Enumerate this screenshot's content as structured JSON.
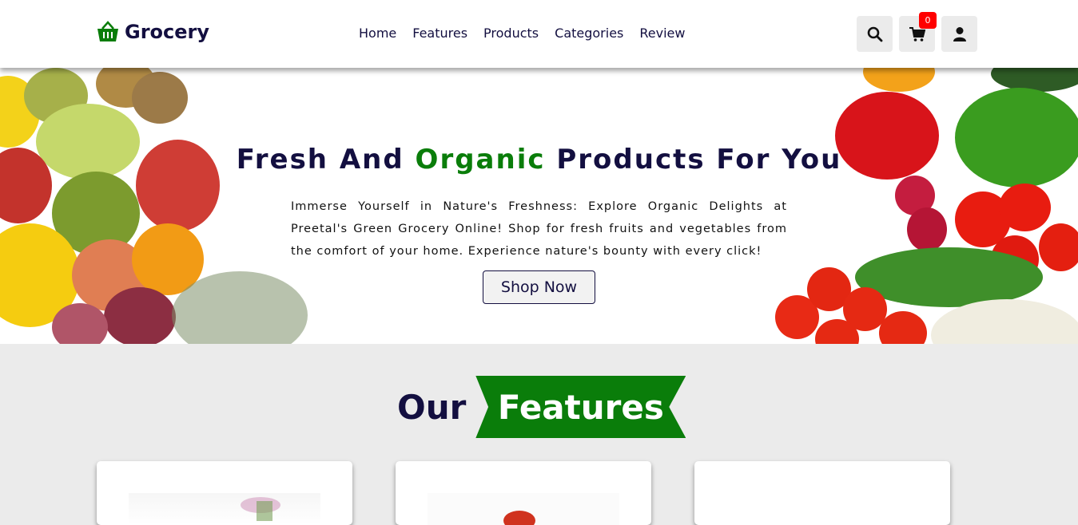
{
  "header": {
    "logo_text": "Grocery",
    "nav": [
      "Home",
      "Features",
      "Products",
      "Categories",
      "Review"
    ],
    "cart_count": "0",
    "icons": [
      "search-icon",
      "cart-icon",
      "user-icon"
    ]
  },
  "hero": {
    "title_before": "Fresh And ",
    "title_highlight": "Organic",
    "title_after": " Products For You",
    "description": "Immerse Yourself in Nature's Freshness: Explore Organic Delights at Preetal's Green Grocery Online! Shop for fresh fruits and vegetables from the comfort of your home. Experience nature's bounty with every click!",
    "button_label": "Shop Now"
  },
  "features": {
    "heading_plain": "Our",
    "heading_highlight": "Features"
  },
  "colors": {
    "accent": "#0a7d0a",
    "text_dark": "#130f40",
    "badge": "#ff0000",
    "section_bg": "#ebebeb"
  }
}
